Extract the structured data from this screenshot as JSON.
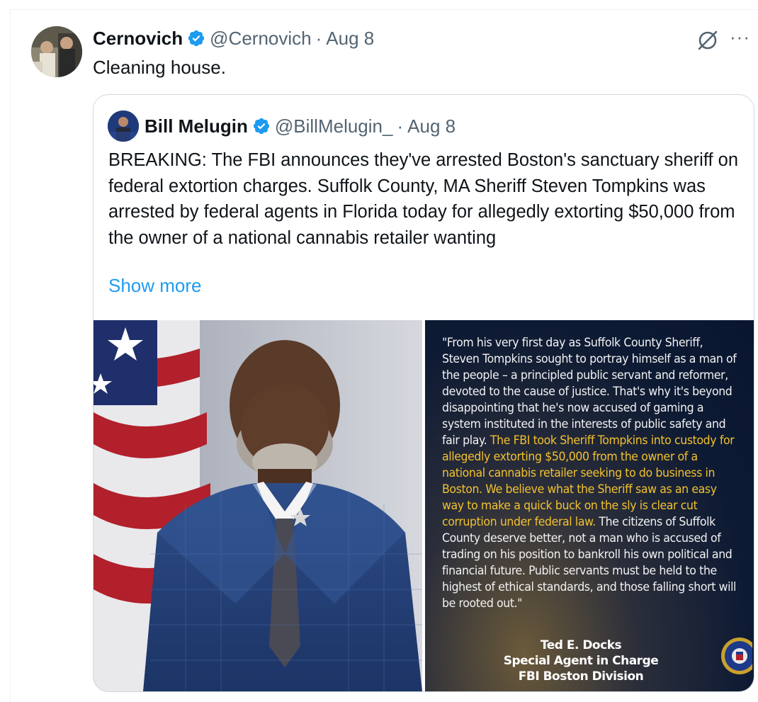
{
  "tweet": {
    "author_name": "Cernovich",
    "handle": "@Cernovich",
    "separator": "·",
    "date": "Aug 8",
    "text": "Cleaning house.",
    "more_label": "···"
  },
  "quoted": {
    "author_name": "Bill Melugin",
    "handle": "@BillMelugin_",
    "separator": "·",
    "date": "Aug 8",
    "text": "BREAKING: The FBI announces they've arrested Boston's sanctuary sheriff on federal extortion charges. Suffolk County, MA Sheriff Steven Tompkins was arrested by federal agents in Florida today for allegedly extorting $50,000 from the owner of a national cannabis retailer wanting",
    "show_more": "Show more"
  },
  "quote_card": {
    "text_plain": "\"From his very first day as Suffolk County Sheriff, Steven Tompkins sought to portray himself as a man of the people – a principled public servant and reformer, devoted to the cause of justice. That's why it's beyond disappointing that he's now accused of gaming a system instituted in the interests of public safety and fair play.",
    "text_highlight": "The FBI took Sheriff Tompkins into custody for allegedly extorting $50,000 from the owner of a national cannabis retailer seeking to do business in Boston. We believe what the Sheriff saw as an easy way to make a quick buck on the sly is clear cut corruption under federal law.",
    "text_end": "The citizens of Suffolk County deserve better, not a man who is accused of trading on his position to bankroll his own political and financial future. Public servants must be held to the highest of ethical standards, and those falling short will be rooted out.\"",
    "sig_name": "Ted E. Docks",
    "sig_title": "Special Agent in Charge",
    "sig_division": "FBI Boston Division"
  },
  "colors": {
    "verified": "#1d9bf0",
    "link": "#1d9bf0",
    "secondary_text": "#536471",
    "highlight": "#f2c12e"
  },
  "icons": [
    "verified-badge-icon",
    "grok-icon",
    "more-icon",
    "fbi-seal-icon"
  ]
}
